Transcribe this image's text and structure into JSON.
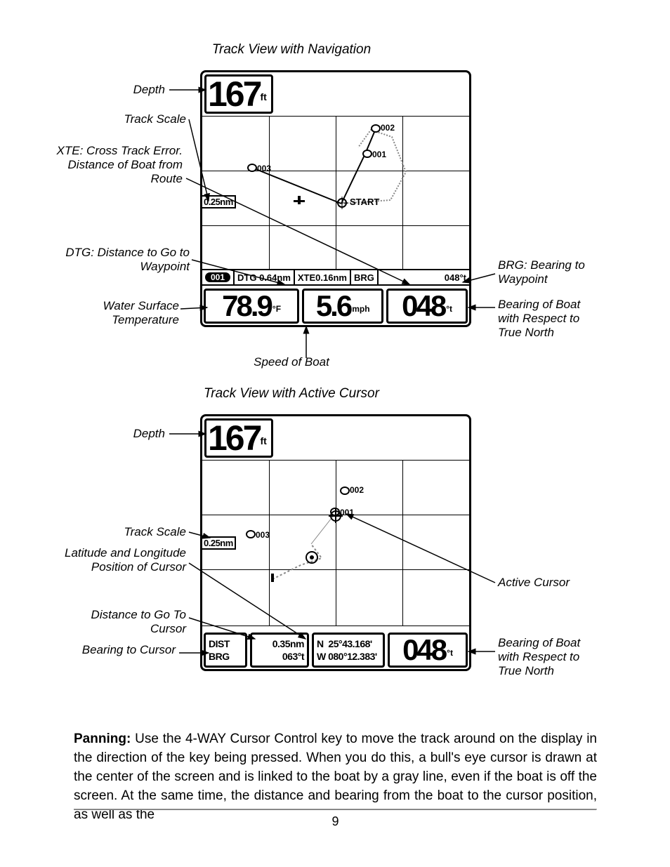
{
  "figures": {
    "nav": {
      "title": "Track View with Navigation",
      "depth": {
        "value": "167",
        "unit": "ft"
      },
      "scaleLabel": "0.25nm",
      "waypointChip": "001",
      "navBar": {
        "dtg": "DTG  0.64nm",
        "xte": "XTE0.16nm",
        "brgLbl": "BRG",
        "brgVal": "048°t"
      },
      "waypoints": {
        "wp001": "001",
        "wp002": "002",
        "wp003": "003",
        "start": "START"
      },
      "readouts": {
        "temp": "78.9",
        "tempUnit": "°F",
        "speed": "5.6",
        "speedUnit": "mph",
        "heading": "048",
        "headingUnit": "°t"
      },
      "leftLabels": {
        "depth": "Depth",
        "trackScale": "Track Scale",
        "xte": "XTE: Cross Track Error. Distance of Boat from Route",
        "dtg": "DTG: Distance to Go to Waypoint",
        "temp": "Water Surface Temperature",
        "speed": "Speed of Boat"
      },
      "rightLabels": {
        "brg": "BRG: Bearing to Waypoint",
        "heading": "Bearing of Boat with Respect to True North"
      }
    },
    "cursor": {
      "title": "Track View with Active Cursor",
      "depth": {
        "value": "167",
        "unit": "ft"
      },
      "scaleLabel": "0.25nm",
      "waypoints": {
        "wp001": "001",
        "wp002": "002",
        "wp003": "003"
      },
      "readouts": {
        "distLbl": "DIST",
        "brgLbl": "BRG",
        "distVal": "0.35nm",
        "brgVal": "063°t",
        "latLbl": "N",
        "latVal": "25°43.168'",
        "lonLbl": "W",
        "lonVal": "080°12.383'",
        "heading": "048",
        "headingUnit": "°t"
      },
      "leftLabels": {
        "depth": "Depth",
        "trackScale": "Track Scale",
        "latlon": "Latitude and Longitude Position of Cursor",
        "dist": "Distance to Go To Cursor",
        "brg": "Bearing to Cursor"
      },
      "rightLabels": {
        "cursor": "Active Cursor",
        "heading": "Bearing of Boat with Respect to True North"
      }
    }
  },
  "bodyText": {
    "bold": "Panning:",
    "rest": " Use the 4-WAY Cursor Control key to move the track around on the display in the direction of the key being pressed.  When you do this, a bull's eye cursor is drawn at the center of the screen and is linked to the boat by a gray line, even if the boat is off the screen. At the same time, the distance and bearing from the boat to the cursor position, as well as the"
  },
  "pageNumber": "9"
}
